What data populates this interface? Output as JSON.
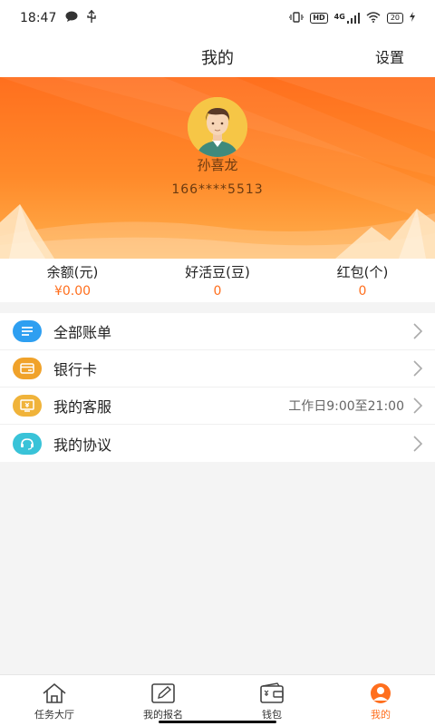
{
  "status_bar": {
    "time": "18:47",
    "chip_hd": "HD",
    "network": "4G",
    "battery": "20"
  },
  "header": {
    "title": "我的",
    "settings_label": "设置"
  },
  "profile": {
    "name": "孙喜龙",
    "phone": "166****5513"
  },
  "stats": [
    {
      "label": "余额(元)",
      "value": "¥0.00"
    },
    {
      "label": "好活豆(豆)",
      "value": "0"
    },
    {
      "label": "红包(个)",
      "value": "0"
    }
  ],
  "menu": [
    {
      "label": "全部账单",
      "icon": "bill-list-icon",
      "color": "#2e9ff1"
    },
    {
      "label": "银行卡",
      "icon": "bank-card-icon",
      "color": "#f0a22a"
    },
    {
      "label": "我的客服",
      "icon": "customer-service-icon",
      "color": "#f0b33a",
      "extra": "工作日9:00至21:00"
    },
    {
      "label": "我的协议",
      "icon": "agreement-icon",
      "color": "#39c3d8"
    }
  ],
  "tabs": [
    {
      "label": "任务大厅",
      "icon": "home-icon"
    },
    {
      "label": "我的报名",
      "icon": "edit-icon"
    },
    {
      "label": "钱包",
      "icon": "wallet-icon"
    },
    {
      "label": "我的",
      "icon": "user-icon",
      "active": true
    }
  ],
  "colors": {
    "accent": "#ff6f1e",
    "hero_top": "#ff6f1e",
    "hero_bottom": "#ffb04d"
  }
}
